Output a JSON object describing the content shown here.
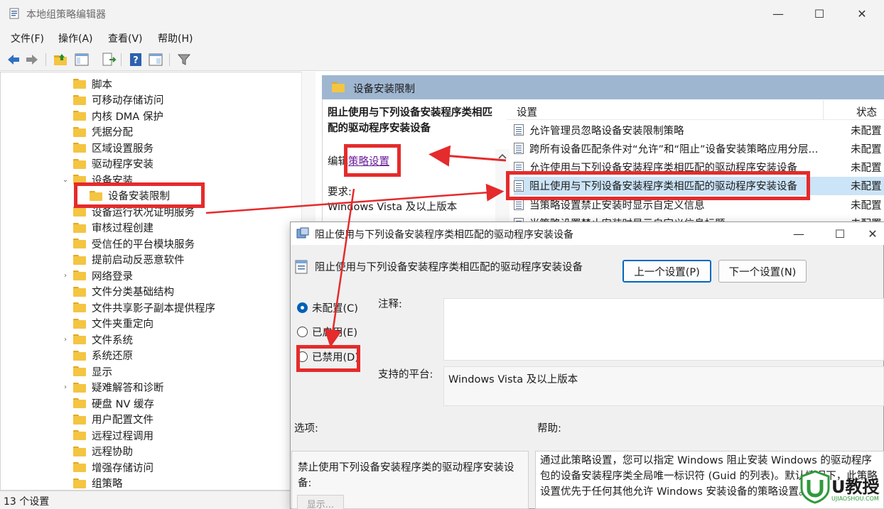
{
  "window": {
    "title": "本地组策略编辑器",
    "minimize": "—",
    "maximize": "☐",
    "close": "✕"
  },
  "menu": [
    "文件(F)",
    "操作(A)",
    "查看(V)",
    "帮助(H)"
  ],
  "tree": {
    "items": [
      {
        "label": "脚本",
        "arrow": ""
      },
      {
        "label": "可移动存储访问",
        "arrow": ""
      },
      {
        "label": "内核 DMA 保护",
        "arrow": ""
      },
      {
        "label": "凭据分配",
        "arrow": ""
      },
      {
        "label": "区域设置服务",
        "arrow": ""
      },
      {
        "label": "驱动程序安装",
        "arrow": ""
      },
      {
        "label": "设备安装",
        "arrow": "⌄"
      },
      {
        "label": "设备安装限制",
        "arrow": ""
      },
      {
        "label": "设备运行状况证明服务",
        "arrow": ""
      },
      {
        "label": "审核过程创建",
        "arrow": ""
      },
      {
        "label": "受信任的平台模块服务",
        "arrow": ""
      },
      {
        "label": "提前启动反恶意软件",
        "arrow": ""
      },
      {
        "label": "网络登录",
        "arrow": "›"
      },
      {
        "label": "文件分类基础结构",
        "arrow": ""
      },
      {
        "label": "文件共享影子副本提供程序",
        "arrow": ""
      },
      {
        "label": "文件夹重定向",
        "arrow": ""
      },
      {
        "label": "文件系统",
        "arrow": "›"
      },
      {
        "label": "系统还原",
        "arrow": ""
      },
      {
        "label": "显示",
        "arrow": ""
      },
      {
        "label": "疑难解答和诊断",
        "arrow": "›"
      },
      {
        "label": "硬盘 NV 缓存",
        "arrow": ""
      },
      {
        "label": "用户配置文件",
        "arrow": ""
      },
      {
        "label": "远程过程调用",
        "arrow": ""
      },
      {
        "label": "远程协助",
        "arrow": ""
      },
      {
        "label": "增强存储访问",
        "arrow": ""
      },
      {
        "label": "组策略",
        "arrow": ""
      }
    ]
  },
  "status": "13 个设置",
  "right_pane": {
    "header": "设备安装限制",
    "desc_title": "阻止使用与下列设备安装程序类相匹配的驱动程序安装设备",
    "edit_prefix": "编辑",
    "edit_link": "策略设置",
    "req_label": "要求:",
    "req_value": "Windows Vista 及以上版本",
    "col_setting": "设置",
    "col_state": "状态",
    "rows": [
      {
        "name": "允许管理员忽略设备安装限制策略",
        "state": "未配置"
      },
      {
        "name": "跨所有设备匹配条件对“允许”和“阻止”设备安装策略应用分层...",
        "state": "未配置"
      },
      {
        "name": "允许使用与下列设备安装程序类相匹配的驱动程序安装设备",
        "state": "未配置"
      },
      {
        "name": "阻止使用与下列设备安装程序类相匹配的驱动程序安装设备",
        "state": "未配置"
      },
      {
        "name": "当策略设置禁止安装时显示自定义信息",
        "state": "未配置"
      },
      {
        "name": "当策略设置禁止安装时显示自定义信息标题",
        "state": "未配置"
      }
    ]
  },
  "dialog": {
    "title": "阻止使用与下列设备安装程序类相匹配的驱动程序安装设备",
    "subtitle": "阻止使用与下列设备安装程序类相匹配的驱动程序安装设备",
    "prev": "上一个设置(P)",
    "next": "下一个设置(N)",
    "minimize": "—",
    "maximize": "☐",
    "close": "✕",
    "radio_not_configured": "未配置(C)",
    "radio_enabled": "已启用(E)",
    "radio_disabled": "已禁用(D)",
    "comment_label": "注释:",
    "platform_label": "支持的平台:",
    "platform_value": "Windows Vista 及以上版本",
    "options_label": "选项:",
    "help_label": "帮助:",
    "options_text": "禁止使用下列设备安装程序类的驱动程序安装设备:",
    "show_button": "显示...",
    "help_text": "通过此策略设置，您可以指定 Windows 阻止安装 Windows 的驱动程序包的设备安装程序类全局唯一标识符 (Guid 的列表)。默认情况下，此策略设置优先于任何其他允许 Windows 安装设备的策略设置。"
  },
  "watermark": {
    "brand": "U教授",
    "site": "UJIAOSHOU.COM"
  },
  "colors": {
    "highlight": "#e52b2b",
    "selection": "#cce4f7",
    "folder": "#f4c542",
    "header": "#9eb6d0",
    "accent": "#005fb8"
  }
}
